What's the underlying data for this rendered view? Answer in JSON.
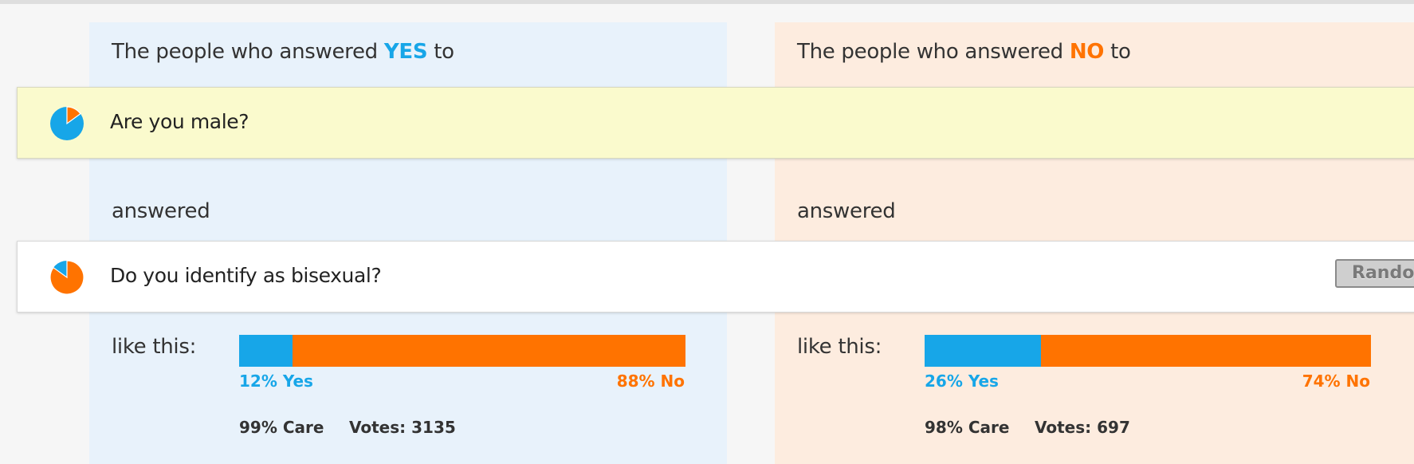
{
  "colors": {
    "yes": "#17a6e8",
    "no": "#ff7300",
    "yes_panel": "#e8f2fb",
    "no_panel": "#fdecdf",
    "question_highlight": "#fafacd"
  },
  "questions": [
    {
      "text": "Are you male?",
      "icon": "pie-chart-icon",
      "yes_fraction": 0.85
    },
    {
      "text": "Do you identify as bisexual?",
      "icon": "pie-chart-icon",
      "yes_fraction": 0.15
    }
  ],
  "random_button": {
    "label": "Rando"
  },
  "panels": {
    "yes": {
      "heading_prefix": "The people who answered",
      "heading_keyword": "YES",
      "heading_suffix": "to",
      "answered_label": "answered",
      "like_label": "like this:",
      "yes_fraction": 0.12,
      "yes_pct_label": "12% Yes",
      "no_pct_label": "88% No",
      "care_label": "99% Care",
      "votes_label": "Votes: 3135"
    },
    "no": {
      "heading_prefix": "The people who answered",
      "heading_keyword": "NO",
      "heading_suffix": "to",
      "answered_label": "answered",
      "like_label": "like this:",
      "yes_fraction": 0.26,
      "yes_pct_label": "26% Yes",
      "no_pct_label": "74% No",
      "care_label": "98% Care",
      "votes_label": "Votes: 697"
    }
  }
}
